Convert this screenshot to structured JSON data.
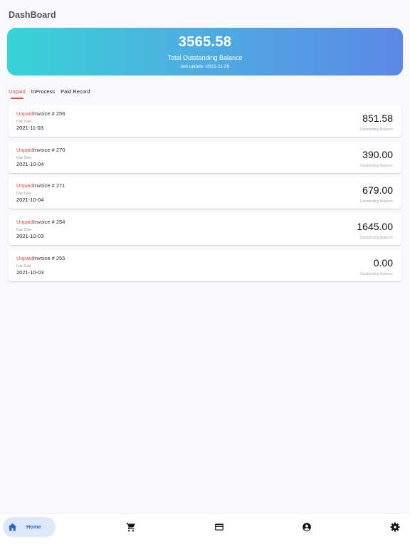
{
  "header": {
    "title": "DashBoard"
  },
  "summary": {
    "total": "3565.58",
    "label": "Total Outstanding Balance",
    "last_update": "last update :2021-11-26"
  },
  "tabs": [
    {
      "label": "Unpaid",
      "active": true
    },
    {
      "label": "InProcess",
      "active": false
    },
    {
      "label": "Paid Record",
      "active": false
    }
  ],
  "invoices": [
    {
      "status": "Unpaid",
      "title": "Invoice # 256",
      "due_label": "Due Date",
      "due_date": "2021-11-03",
      "amount": "851.58",
      "amount_label": "Outstanding Balance"
    },
    {
      "status": "Unpaid",
      "title": "Invoice # 270",
      "due_label": "Due Date",
      "due_date": "2021-10-04",
      "amount": "390.00",
      "amount_label": "Outstanding Balance"
    },
    {
      "status": "Unpaid",
      "title": "Invoice # 271",
      "due_label": "Due Date",
      "due_date": "2021-10-04",
      "amount": "679.00",
      "amount_label": "Outstanding Balance"
    },
    {
      "status": "Unpaid",
      "title": "Invoice # 254",
      "due_label": "Due Date",
      "due_date": "2021-10-03",
      "amount": "1645.00",
      "amount_label": "Outstanding Balance"
    },
    {
      "status": "Unpaid",
      "title": "Invoice # 255",
      "due_label": "Due Date",
      "due_date": "2021-10-03",
      "amount": "0.00",
      "amount_label": "Outstanding Balance"
    }
  ],
  "bottom_nav": {
    "home_label": "Home",
    "items": [
      "home-icon",
      "cart-icon",
      "credit-card-icon",
      "account-circle-icon",
      "settings-gear-icon"
    ]
  },
  "colors": {
    "accent_red": "#e04b43",
    "gradient_start": "#36d4d6",
    "gradient_end": "#5b88e6",
    "nav_active_bg": "#dde9fb",
    "nav_active_fg": "#2f67c9"
  }
}
